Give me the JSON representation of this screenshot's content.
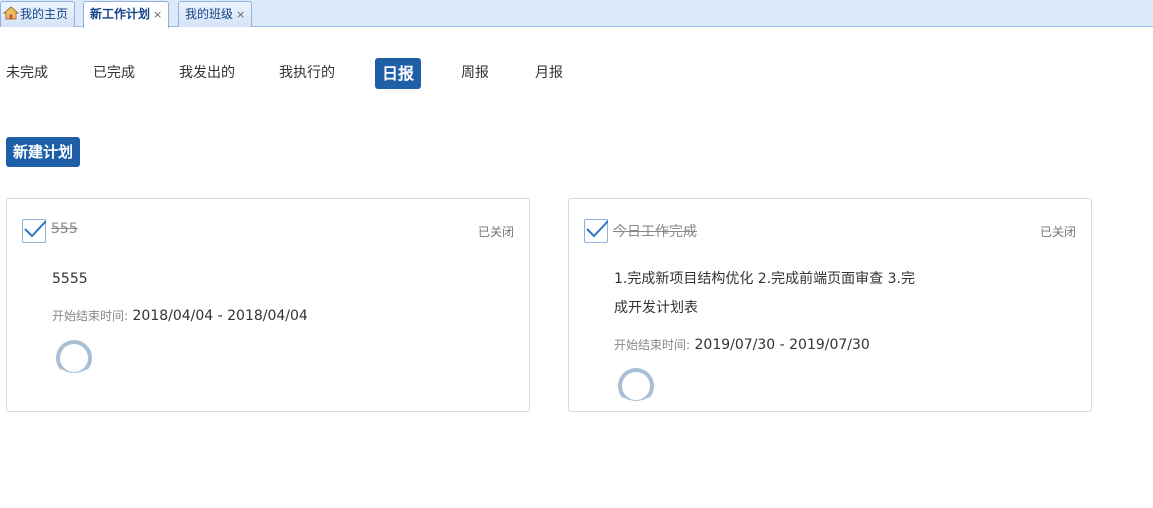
{
  "tabs": [
    {
      "label": "我的主页",
      "closable": false,
      "active": false,
      "icon": "home-icon"
    },
    {
      "label": "新工作计划",
      "closable": true,
      "active": true
    },
    {
      "label": "我的班级",
      "closable": true,
      "active": false
    }
  ],
  "close_glyph": "×",
  "nav": [
    {
      "label": "未完成",
      "active": false
    },
    {
      "label": "已完成",
      "active": false
    },
    {
      "label": "我发出的",
      "active": false
    },
    {
      "label": "我执行的",
      "active": false
    },
    {
      "label": "日报",
      "active": true
    },
    {
      "label": "周报",
      "active": false
    },
    {
      "label": "月报",
      "active": false
    }
  ],
  "new_plan_button": "新建计划",
  "plans": [
    {
      "title": "555",
      "status": "已关闭",
      "content": "5555",
      "date_label": "开始结束时间:",
      "date_range": "2018/04/04 - 2018/04/04",
      "checked": true
    },
    {
      "title": "今日工作完成",
      "status": "已关闭",
      "content": "1.完成新项目结构优化 2.完成前端页面审查 3.完成开发计划表",
      "date_label": "开始结束时间:",
      "date_range": "2019/07/30 - 2019/07/30",
      "checked": true
    }
  ],
  "colors": {
    "primary": "#1f5fa8",
    "tabbar_bg": "#dde9f8",
    "check_blue": "#2a74c9",
    "avatar_ring": "#a9bfd6"
  }
}
